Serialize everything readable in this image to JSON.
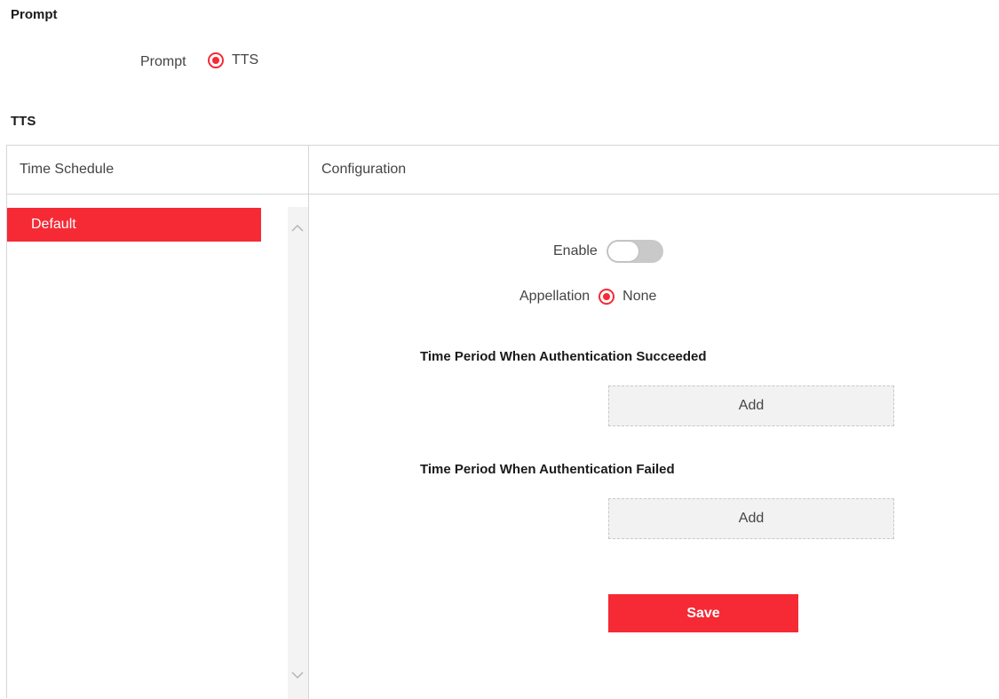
{
  "prompt_section": {
    "title": "Prompt",
    "field_label": "Prompt",
    "selected_option": "TTS"
  },
  "tts_section": {
    "title": "TTS",
    "columns": [
      "Time Schedule",
      "Configuration"
    ],
    "schedules": [
      {
        "label": "Default",
        "selected": true
      }
    ]
  },
  "config": {
    "enable_label": "Enable",
    "enable_on": false,
    "appellation_label": "Appellation",
    "appellation_selected": "None",
    "succeeded_title": "Time Period When Authentication Succeeded",
    "succeeded_add_label": "Add",
    "failed_title": "Time Period When Authentication Failed",
    "failed_add_label": "Add",
    "save_label": "Save"
  },
  "colors": {
    "accent": "#f52a35",
    "border": "#d6d6d6",
    "toggle_off": "#c9c9c9"
  },
  "icons": [
    "radio-selected-icon",
    "chevron-up-icon",
    "chevron-down-icon"
  ]
}
